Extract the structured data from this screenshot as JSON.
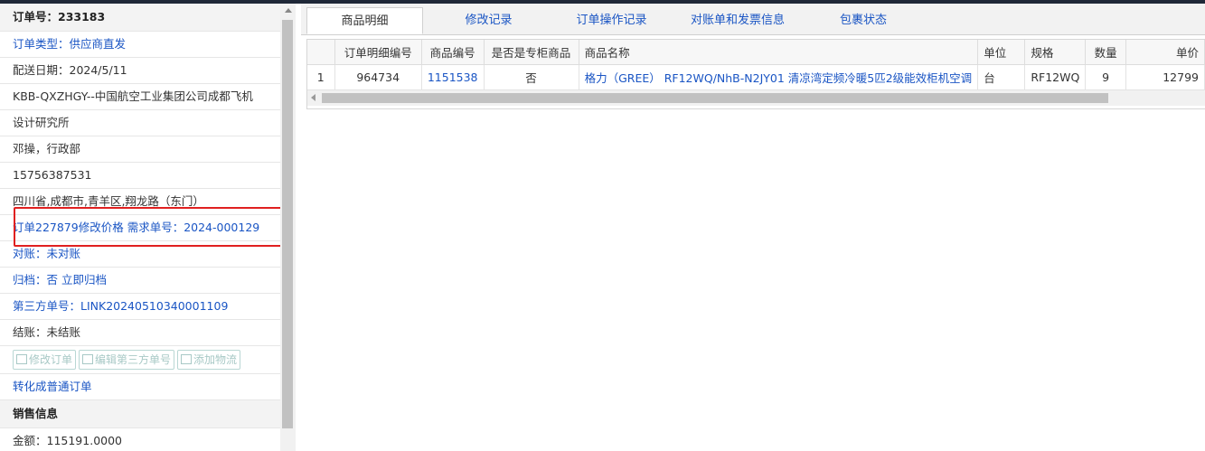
{
  "order": {
    "number_label": "订单号：233183",
    "type_label": "订单类型：供应商直发",
    "delivery_date": "配送日期：2024/5/11",
    "company_line1": "KBB-QXZHGY--中国航空工业集团公司成都飞机",
    "company_line2": "设计研究所",
    "contact": "邓操，行政部",
    "phone": "15756387531",
    "address": "四川省,成都市,青羊区,翔龙路（东门）",
    "remark": "订单227879修改价格 需求单号：2024-000129",
    "reconcile": "对账：未对账",
    "archive_prefix": "归档：",
    "archive_value": "否 立即归档",
    "third_party": "第三方单号：LINK20240510340001109",
    "settlement": "结账：未结账",
    "buttons": {
      "edit_order": "修改订单",
      "edit_third": "编辑第三方单号",
      "add_logistics": "添加物流"
    },
    "convert": "转化成普通订单",
    "sales_header": "销售信息",
    "amount": "金额：115191.0000"
  },
  "tabs": [
    "商品明细",
    "修改记录",
    "订单操作记录",
    "对账单和发票信息",
    "包裹状态"
  ],
  "table": {
    "headers": [
      "",
      "订单明细编号",
      "商品编号",
      "是否是专柜商品",
      "商品名称",
      "单位",
      "规格",
      "数量",
      "单价"
    ],
    "rows": [
      [
        "1",
        "964734",
        "1151538",
        "否",
        "格力（GREE） RF12WQ/NhB-N2JY01 清凉湾定频冷暖5匹2级能效柜机空调",
        "台",
        "RF12WQ",
        "9",
        "12799"
      ]
    ]
  },
  "colors": {
    "link": "#1a55c4",
    "highlight_box": "#e02020"
  }
}
